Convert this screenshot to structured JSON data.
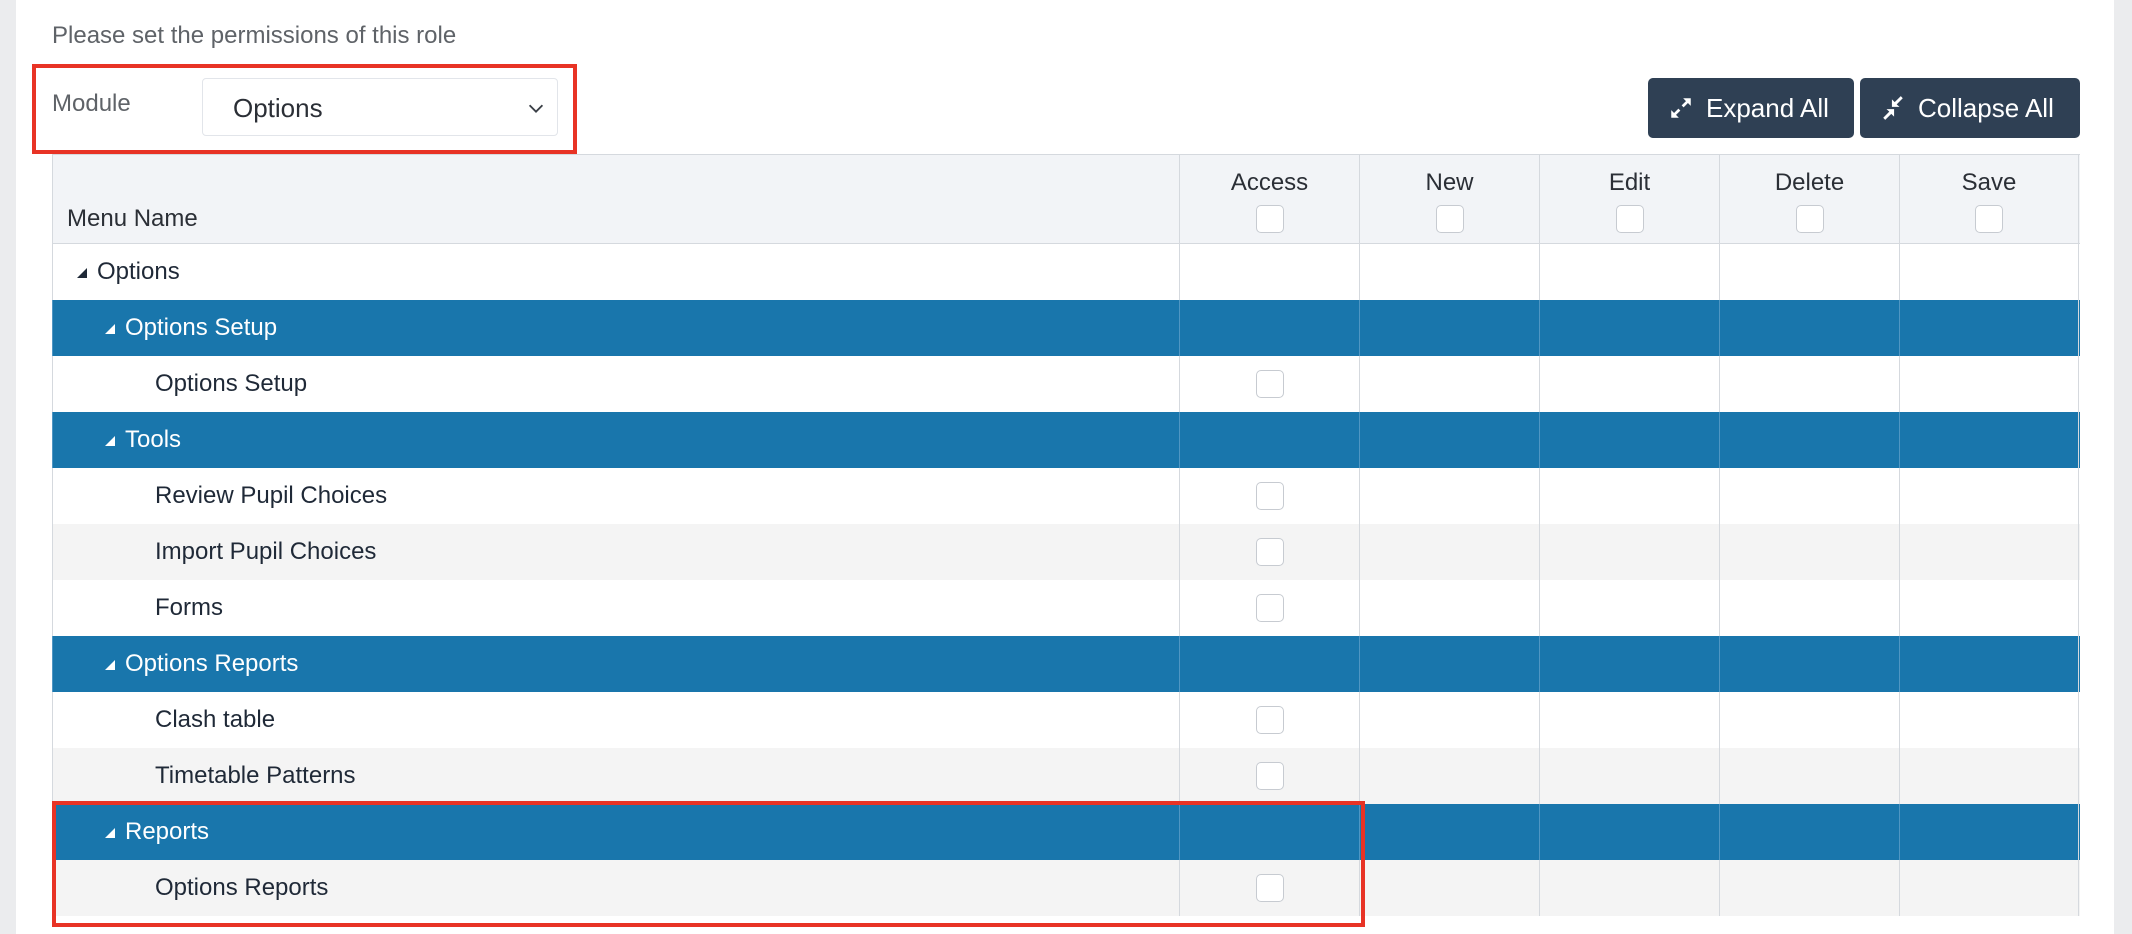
{
  "intro": "Please set the permissions of this role",
  "module": {
    "label": "Module",
    "value": "Options"
  },
  "buttons": {
    "expand_all": "Expand All",
    "collapse_all": "Collapse All"
  },
  "table": {
    "menu_header": "Menu Name",
    "columns": [
      "Access",
      "New",
      "Edit",
      "Delete",
      "Save"
    ]
  },
  "rows": [
    {
      "label": "Options"
    },
    {
      "label": "Options Setup"
    },
    {
      "label": "Options Setup"
    },
    {
      "label": "Tools"
    },
    {
      "label": "Review Pupil Choices"
    },
    {
      "label": "Import Pupil Choices"
    },
    {
      "label": "Forms"
    },
    {
      "label": "Options Reports"
    },
    {
      "label": "Clash table"
    },
    {
      "label": "Timetable Patterns"
    },
    {
      "label": "Reports"
    },
    {
      "label": "Options Reports"
    }
  ],
  "colors": {
    "group_row": "#1976ac",
    "button": "#2f4054",
    "highlight": "#e83325"
  }
}
